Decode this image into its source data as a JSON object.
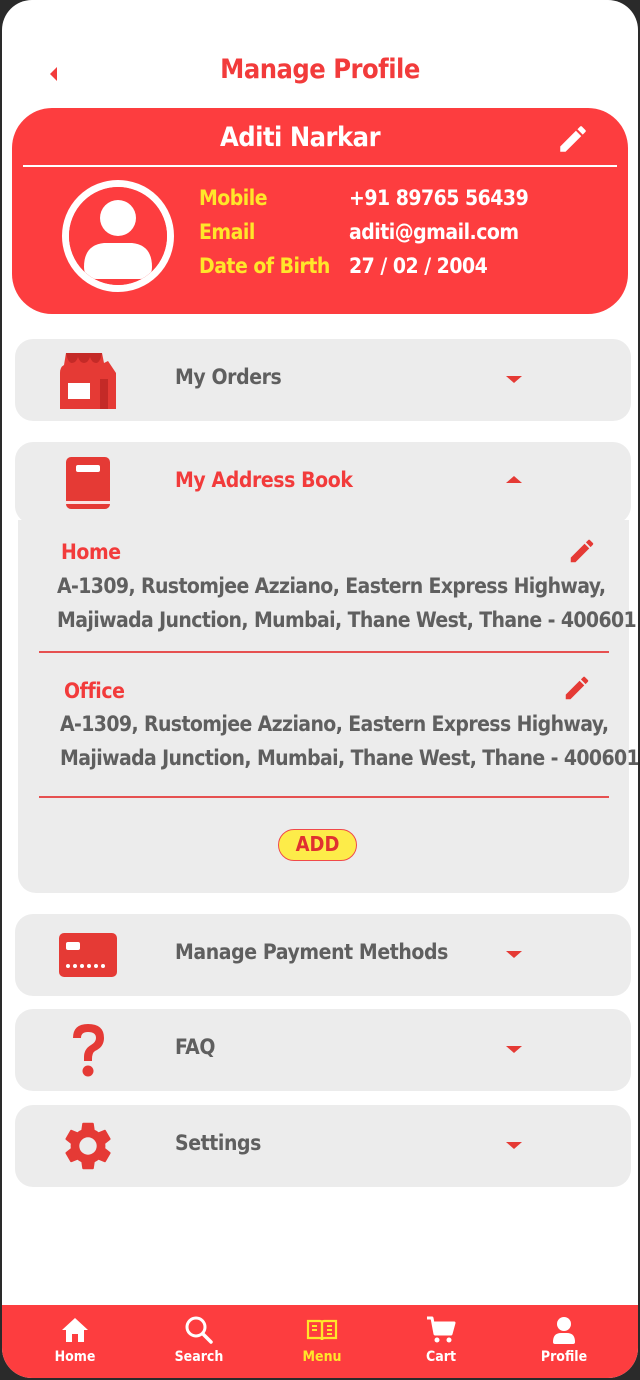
{
  "header": {
    "title": "Manage Profile"
  },
  "profile": {
    "name": "Aditi Narkar",
    "fields": [
      {
        "key": "Mobile",
        "value": "+91 89765 56439"
      },
      {
        "key": "Email",
        "value": "aditi@gmail.com"
      },
      {
        "key": "Date of Birth",
        "value": "27 / 02 / 2004"
      }
    ]
  },
  "sections": {
    "orders": {
      "label": "My Orders",
      "icon": "store-icon"
    },
    "address_book": {
      "label": "My Address Book",
      "icon": "book-icon"
    },
    "payment": {
      "label": "Manage Payment Methods",
      "icon": "credit-card-icon"
    },
    "faq": {
      "label": "FAQ",
      "icon": "question-mark-icon"
    },
    "settings": {
      "label": "Settings",
      "icon": "gear-icon"
    }
  },
  "addresses": [
    {
      "label": "Home",
      "line1": "A-1309, Rustomjee Azziano, Eastern Express Highway,",
      "line2": "Majiwada Junction, Mumbai, Thane West, Thane - 400601"
    },
    {
      "label": "Office",
      "line1": "A-1309, Rustomjee Azziano, Eastern Express Highway,",
      "line2": "Majiwada Junction, Mumbai, Thane West, Thane - 400601"
    }
  ],
  "add_button": "ADD",
  "nav": {
    "items": [
      {
        "label": "Home",
        "icon": "home-icon"
      },
      {
        "label": "Search",
        "icon": "search-icon"
      },
      {
        "label": "Menu",
        "icon": "menu-book-icon"
      },
      {
        "label": "Cart",
        "icon": "cart-icon"
      },
      {
        "label": "Profile",
        "icon": "profile-icon"
      }
    ],
    "active": "Menu"
  },
  "colors": {
    "primary": "#fd3d3f",
    "accent_yellow": "#ffe62a",
    "panel_gray": "#ececec",
    "text_gray": "#5f5f5f"
  }
}
